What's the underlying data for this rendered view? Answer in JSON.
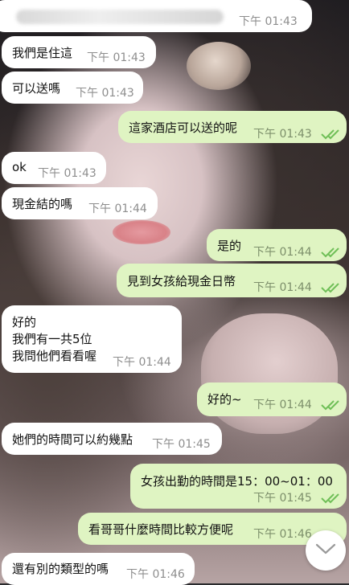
{
  "messages": [
    {
      "text": "",
      "time": "下午 01:43"
    },
    {
      "text": "我們是住這",
      "time": "下午 01:43"
    },
    {
      "text": "可以送嗎",
      "time": "下午 01:43"
    },
    {
      "text": "這家酒店可以送的呢",
      "time": "下午 01:43"
    },
    {
      "text": "ok",
      "time": "下午 01:43"
    },
    {
      "text": "現金結的嗎",
      "time": "下午 01:44"
    },
    {
      "text": "是的",
      "time": "下午 01:44"
    },
    {
      "text": "見到女孩給現金日幣",
      "time": "下午 01:44"
    },
    {
      "lines": [
        "好的",
        "我們有一共5位",
        "我問他們看看喔"
      ],
      "time": "下午 01:44"
    },
    {
      "text": "好的~",
      "time": "下午 01:44"
    },
    {
      "text": "她們的時間可以約幾點",
      "time": "下午 01:45"
    },
    {
      "text": "女孩出勤的時間是15：00~01：00",
      "time": "下午 01:45"
    },
    {
      "text": "看哥哥什麼時間比較方便呢",
      "time": "下午 01:46"
    },
    {
      "text": "還有別的類型的嗎",
      "time": "下午 01:46"
    }
  ],
  "colors": {
    "incoming_bubble": "#ffffff",
    "outgoing_bubble": "#dff4c2",
    "read_check": "#6fbf57"
  },
  "icons": {
    "read_receipt": "double-check-icon",
    "scroll_down": "chevron-down-icon"
  }
}
